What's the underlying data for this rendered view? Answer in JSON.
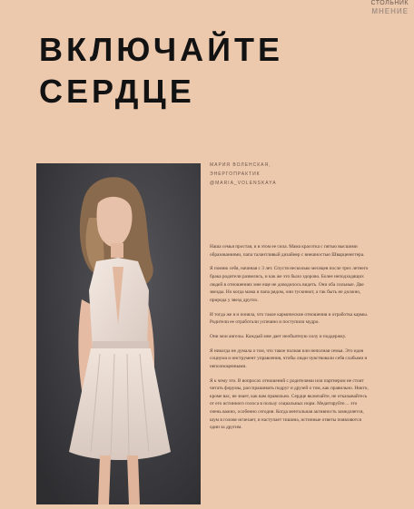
{
  "brand": {
    "line1": "СТОЛЬНИК",
    "line2": "МНЕНИЕ"
  },
  "headline": {
    "line1": "ВКЛЮЧАЙТЕ",
    "line2": "СЕРДЦЕ"
  },
  "author": {
    "name": "МАРИЯ ВОЛЕНСКАЯ,",
    "role": "ЭНЕРГОПРАКТИК",
    "handle": "@MARIA_VOLENSKAYA"
  },
  "photo": {
    "alt": "Девушка в светлом платье на сером фоне"
  },
  "paragraphs": [
    "Наша семья простая, и в этом ее сила. Мама красотка с пятью высшими образованиями, папа талантливый дизайнер с внешностью Шварценеггера.",
    "Я помню себя, начиная с 3 лет. Спустя несколько месяцев после трех летнего брака родители развелись, и как же это было здорово. Более неподходящих людей в отношениях мне еще не доводилось видеть. Они оба сильные. Две звезды. Но когда мама и папа рядом, они тускнеют, а так быть не должно, природа у звезд других.",
    "И тогда же я и поняла, что такое кармические отношения и отработка кармы. Родители ее отработали успешно и поступили мудро.",
    "Они мои ангелы. Каждый мне дает необъятную силу и поддержку.",
    "Я никогда не думала о том, что такое полная или неполная семья. Это идея социума и инструмент управления, чтобы люди чувствовали себя слабыми и неполноценными.",
    "Я к чему это. В вопросах отношений с родителями или партнером не стоит читать форумы, расспрашивать подруг и друзей о том, как правильно. Никто, кроме вас, не знает, как вам правильно. Сердце включайте, не отказывайтесь от его истинного голоса в пользу социальных норм. Медитируйте… это очень важно, особенно сегодня. Когда ментальная активность замедляется, шум в голове исчезает, и наступает тишина, истинные ответы появляются один за другим."
  ],
  "colors": {
    "page_background": "#ecc8ad",
    "headline": "#121212",
    "body_text": "#4a382e"
  }
}
